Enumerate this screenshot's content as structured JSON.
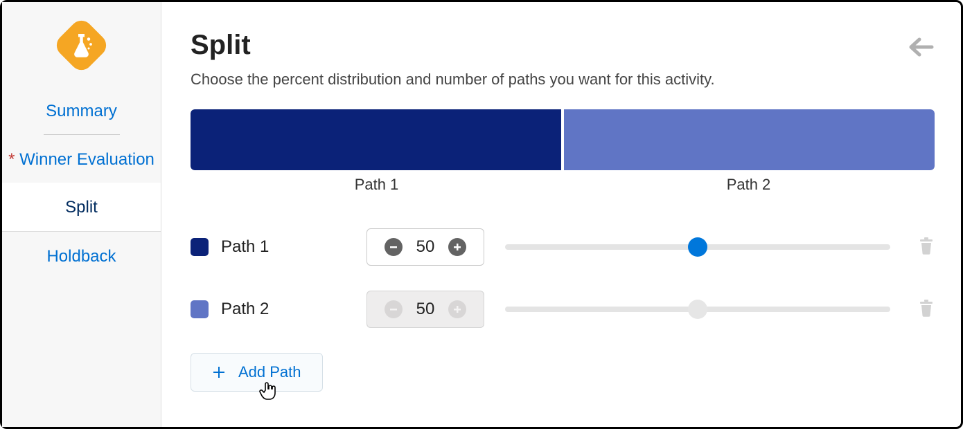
{
  "sidebar": {
    "items": [
      {
        "label": "Summary"
      },
      {
        "label": "Winner Evaluation",
        "required": true
      },
      {
        "label": "Split"
      },
      {
        "label": "Holdback"
      }
    ]
  },
  "header": {
    "title": "Split",
    "subtitle": "Choose the percent distribution and number of paths you want for this activity."
  },
  "distribution": {
    "segments": [
      {
        "label": "Path 1",
        "percent": 50
      },
      {
        "label": "Path 2",
        "percent": 50
      }
    ]
  },
  "paths": [
    {
      "name": "Path 1",
      "value": 50,
      "enabled": true
    },
    {
      "name": "Path 2",
      "value": 50,
      "enabled": false
    }
  ],
  "buttons": {
    "add_path": "Add Path"
  }
}
